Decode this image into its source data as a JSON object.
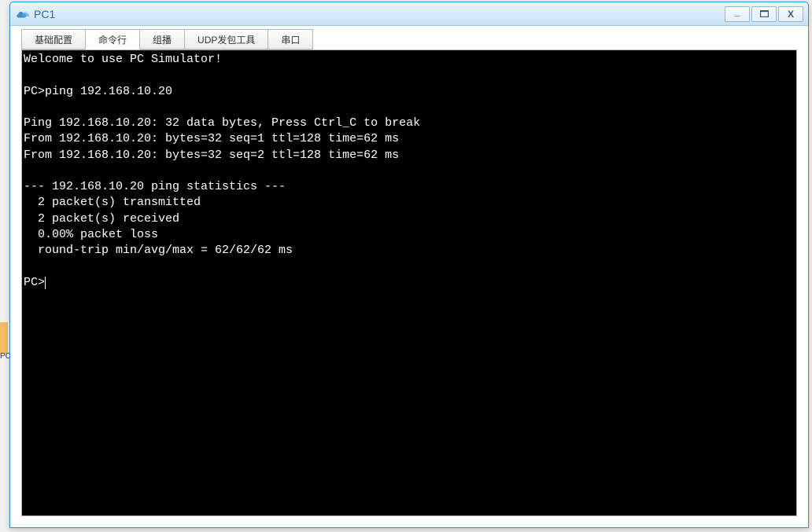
{
  "desktop": {
    "icon_label": "PC"
  },
  "window": {
    "title": "PC1"
  },
  "tabs": [
    {
      "label": "基础配置",
      "active": false
    },
    {
      "label": "命令行",
      "active": true
    },
    {
      "label": "组播",
      "active": false
    },
    {
      "label": "UDP发包工具",
      "active": false
    },
    {
      "label": "串口",
      "active": false
    }
  ],
  "terminal": {
    "lines": [
      "Welcome to use PC Simulator!",
      "",
      "PC>ping 192.168.10.20",
      "",
      "Ping 192.168.10.20: 32 data bytes, Press Ctrl_C to break",
      "From 192.168.10.20: bytes=32 seq=1 ttl=128 time=62 ms",
      "From 192.168.10.20: bytes=32 seq=2 ttl=128 time=62 ms",
      "",
      "--- 192.168.10.20 ping statistics ---",
      "  2 packet(s) transmitted",
      "  2 packet(s) received",
      "  0.00% packet loss",
      "  round-trip min/avg/max = 62/62/62 ms",
      "",
      "PC>"
    ],
    "prompt_cursor": true
  },
  "controls": {
    "minimize": "—",
    "maximize": "□",
    "close": "X"
  }
}
